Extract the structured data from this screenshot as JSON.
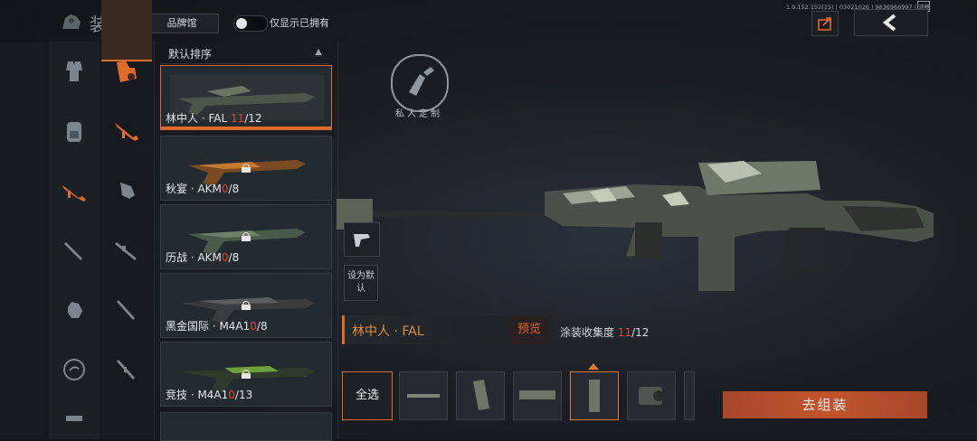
{
  "header": {
    "title": "装扮",
    "brand_button": "品牌馆",
    "toggle_label": "仅显示已拥有",
    "toggle_on": false,
    "version": "1.0.152.152(15) | 03021026 | 9836966997 | 流畅",
    "share_icon": "share-icon",
    "back_icon": "back-arrow-icon"
  },
  "categories": {
    "left": [
      "outfit-icon",
      "backpack-icon",
      "rifle-icon",
      "knife-icon",
      "glove-icon",
      "emote-icon"
    ],
    "right": [
      "spray-icon",
      "assault-rifle-icon",
      "smg-icon",
      "sniper-icon",
      "shotgun-icon",
      "marksman-icon"
    ],
    "selected_right": 1,
    "accent": "#e06a2a"
  },
  "skin_list": {
    "sort_label": "默认排序",
    "items": [
      {
        "name": "林中人 · FAL",
        "owned": "11",
        "total": "/12",
        "locked": false,
        "selected": true
      },
      {
        "name": "秋宴 · AKM",
        "owned": "0",
        "total": "/8",
        "locked": true,
        "selected": false
      },
      {
        "name": "历战 · AKM",
        "owned": "0",
        "total": "/8",
        "locked": true,
        "selected": false
      },
      {
        "name": "黑金国际 · M4A1",
        "owned": "0",
        "total": "/8",
        "locked": true,
        "selected": false
      },
      {
        "name": "竞技 · M4A1",
        "owned": "0",
        "total": "/13",
        "locked": true,
        "selected": false
      }
    ]
  },
  "detail": {
    "logo_text": "私人定制",
    "set_default": "设为默认",
    "weapon_name": "林中人 · FAL",
    "preview_label": "预览",
    "collection_label": "涂装收集度",
    "collection_owned": "11",
    "collection_total": "/12",
    "select_all": "全选",
    "parts": [
      "barrel-icon",
      "magazine-icon",
      "receiver-icon",
      "stock-icon",
      "scope-icon"
    ],
    "assemble": "去组装"
  }
}
